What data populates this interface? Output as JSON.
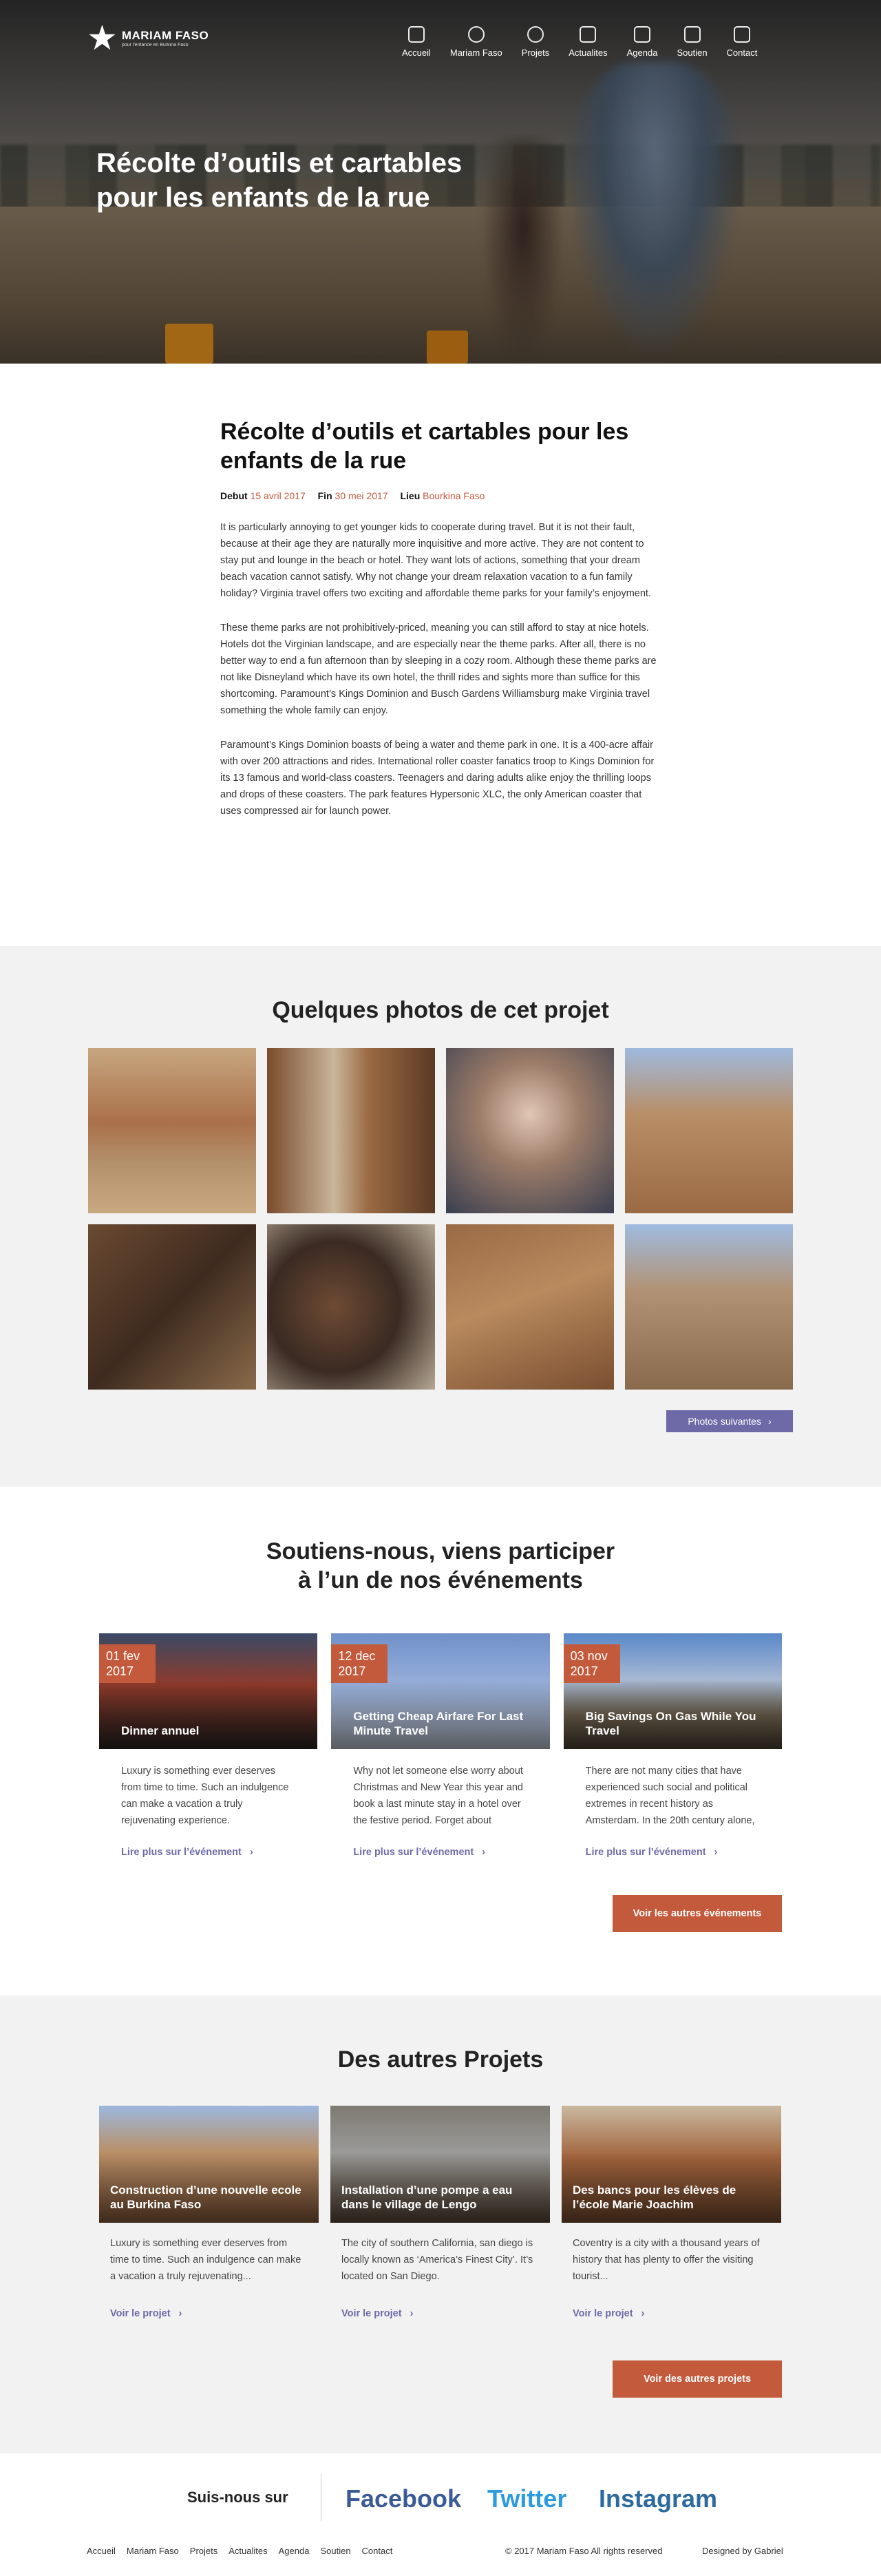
{
  "brand": {
    "name": "MARIAM FASO",
    "tagline": "pour l'enfance en Burkina Faso",
    "star": "★"
  },
  "nav": [
    {
      "label": "Accueil",
      "icon": "home-icon"
    },
    {
      "label": "Mariam Faso",
      "icon": "smile-icon"
    },
    {
      "label": "Projets",
      "icon": "tools-icon"
    },
    {
      "label": "Actualites",
      "icon": "news-icon"
    },
    {
      "label": "Agenda",
      "icon": "calendar-icon"
    },
    {
      "label": "Soutien",
      "icon": "support-icon"
    },
    {
      "label": "Contact",
      "icon": "contact-icon"
    }
  ],
  "hero": {
    "title": "Récolte d’outils et cartables pour les enfants de la rue"
  },
  "article": {
    "title": "Récolte d’outils et cartables pour les enfants de la rue",
    "debut_label": "Debut",
    "debut_value": "15 avril 2017",
    "fin_label": "Fin",
    "fin_value": "30 mei 2017",
    "lieu_label": "Lieu",
    "lieu_value": "Bourkina Faso",
    "paragraphs": [
      "It is particularly annoying to get younger kids to cooperate during travel. But it is not their fault, because at their age they are naturally more inquisitive and more active. They are not content to stay put and lounge in the beach or hotel. They want lots of actions, something that your dream beach vacation cannot satisfy. Why not change your dream relaxation vacation to a fun family holiday? Virginia travel offers two exciting and affordable theme parks for your family’s enjoyment.",
      "These theme parks are not prohibitively-priced, meaning you can still afford to stay at nice hotels. Hotels dot the Virginian landscape, and are especially near the theme parks. After all, there is no better way to end a fun afternoon than by sleeping in a cozy room. Although these theme parks are not like Disneyland which have its own hotel, the thrill rides and sights more than suffice for this shortcoming. Paramount’s Kings Dominion and Busch Gardens Williamsburg make Virginia travel something the whole family can enjoy.",
      "Paramount’s Kings Dominion boasts of being a water and theme park in one. It is a 400-acre affair with over 200 attractions and rides. International roller coaster fanatics troop to Kings Dominion for its 13 famous and world-class coasters. Teenagers and daring adults alike enjoy the thrilling loops and drops of these coasters. The park features Hypersonic XLC, the only American coaster that uses compressed air for launch power."
    ]
  },
  "photos": {
    "title": "Quelques photos de cet projet",
    "next_label": "Photos suivantes",
    "next_icon": "chevron-right-icon"
  },
  "events": {
    "title_line1": "Soutiens-nous, viens participer",
    "title_line2": "à l’un de nos événements",
    "items": [
      {
        "day": "01 fev",
        "year": "2017",
        "title": "Dinner annuel",
        "text": "Luxury is something ever  deserves from time to time. Such an indulgence can make a vacation a truly rejuvenating experience.",
        "link": "Lire plus sur l’événement"
      },
      {
        "day": "12 dec",
        "year": "2017",
        "title": "Getting Cheap Airfare For Last Minute Travel",
        "text": "Why not let someone else worry about Christmas and New Year this year and book a last minute stay in a hotel over the festive period. Forget about",
        "link": "Lire plus sur l’événement"
      },
      {
        "day": "03 nov",
        "year": "2017",
        "title": "Big Savings On Gas While You Travel",
        "text": "There are not many cities that have experienced such social and political extremes in recent history as Amsterdam. In the 20th century alone,",
        "link": "Lire plus sur l’événement"
      }
    ],
    "cta": "Voir les autres événements"
  },
  "projects": {
    "title": "Des autres Projets",
    "items": [
      {
        "title": "Construction d’une nouvelle ecole au Burkina Faso",
        "text": "Luxury is something ever  deserves from time to time. Such an indulgence can make a vacation a truly rejuvenating...",
        "link": "Voir le projet"
      },
      {
        "title": "Installation d’une pompe a eau dans  le village de Lengo",
        "text": "The city of southern California, san diego is locally known as ‘America’s Finest City’. It’s located on San Diego.",
        "link": "Voir le projet"
      },
      {
        "title": "Des bancs pour les élèves de l’école Marie Joachim",
        "text": "Coventry is a city with a thousand years of history that has plenty to offer the visiting tourist...",
        "link": "Voir le projet"
      }
    ],
    "cta": "Voir des autres projets"
  },
  "footer": {
    "follow_label": "Suis-nous sur",
    "facebook": "Facebook",
    "twitter": "Twitter",
    "instagram": "Instagram",
    "nav": [
      "Accueil",
      "Mariam Faso",
      "Projets",
      "Actualites",
      "Agenda",
      "Soutien",
      "Contact"
    ],
    "copyright": "© 2017 Mariam Faso All rights reserved",
    "credit": "Designed by Gabriel"
  },
  "colors": {
    "accent": "#c45a3c",
    "link": "#6e6aa8",
    "facebook": "#3b5b98",
    "twitter": "#2d9be0",
    "instagram": "#2d6aa0"
  }
}
